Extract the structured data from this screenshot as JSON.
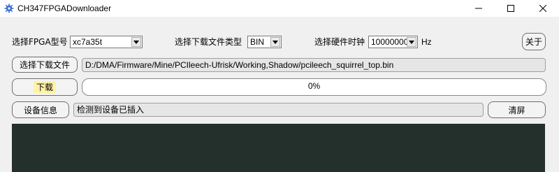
{
  "window": {
    "title": "CH347FPGADownloader"
  },
  "toolbar": {
    "fpga_model_label": "选择FPGA型号",
    "fpga_model_value": "xc7a35t",
    "file_type_label": "选择下载文件类型",
    "file_type_value": "BIN",
    "clock_label": "选择硬件时钟",
    "clock_value": "10000000",
    "clock_unit": "Hz",
    "about_button": "关于"
  },
  "file": {
    "select_button": "选择下载文件",
    "path": "D:/DMA/Firmware/Mine/PCIleech-Ufrisk/Working,Shadow/pcileech_squirrel_top.bin"
  },
  "download": {
    "button": "下载",
    "progress_text": "0%",
    "progress_value": 0
  },
  "device": {
    "info_button": "设备信息",
    "status": "检测到设备已插入",
    "clear_button": "清屏"
  },
  "colors": {
    "console_bg": "#24302b",
    "progress_fill": "#06b025",
    "highlight": "#fff2a8"
  }
}
